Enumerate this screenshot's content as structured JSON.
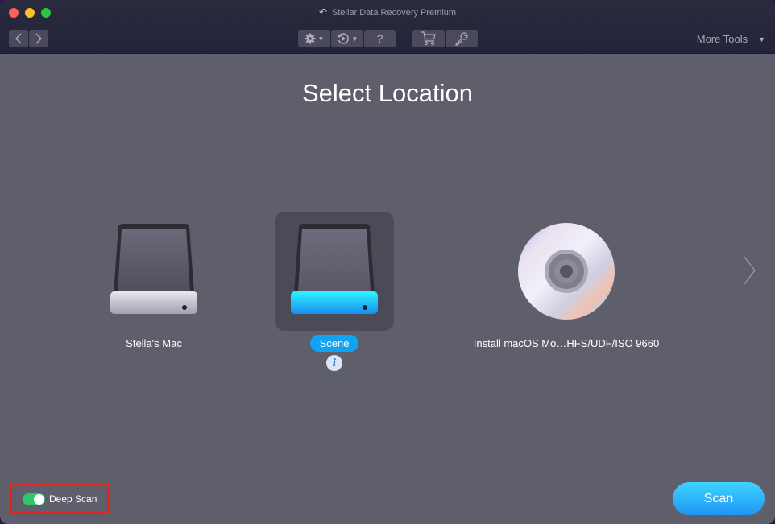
{
  "window": {
    "title": "Stellar Data Recovery Premium"
  },
  "toolbar": {
    "back_label": "<",
    "forward_label": ">",
    "help_label": "?",
    "more_tools_label": "More Tools",
    "icons": [
      "chevron-left-icon",
      "chevron-right-icon",
      "gear-icon",
      "history-icon",
      "help-icon",
      "cart-icon",
      "key-icon"
    ]
  },
  "main": {
    "title": "Select Location",
    "drives": [
      {
        "label": "Stella's Mac",
        "icon": "hard-drive-icon",
        "selected": false
      },
      {
        "label": "Scene",
        "icon": "external-drive-icon",
        "selected": true
      },
      {
        "label": "Install macOS Mo…HFS/UDF/ISO 9660",
        "icon": "optical-disc-icon",
        "selected": false
      }
    ],
    "info_label": "i"
  },
  "footer": {
    "deep_scan_label": "Deep Scan",
    "deep_scan_enabled": true,
    "scan_button_label": "Scan"
  },
  "colors": {
    "accent": "#0fa4f2",
    "toggle_on": "#2fc66a",
    "highlight_box": "#e8211c",
    "background": "#5f5f6c"
  }
}
